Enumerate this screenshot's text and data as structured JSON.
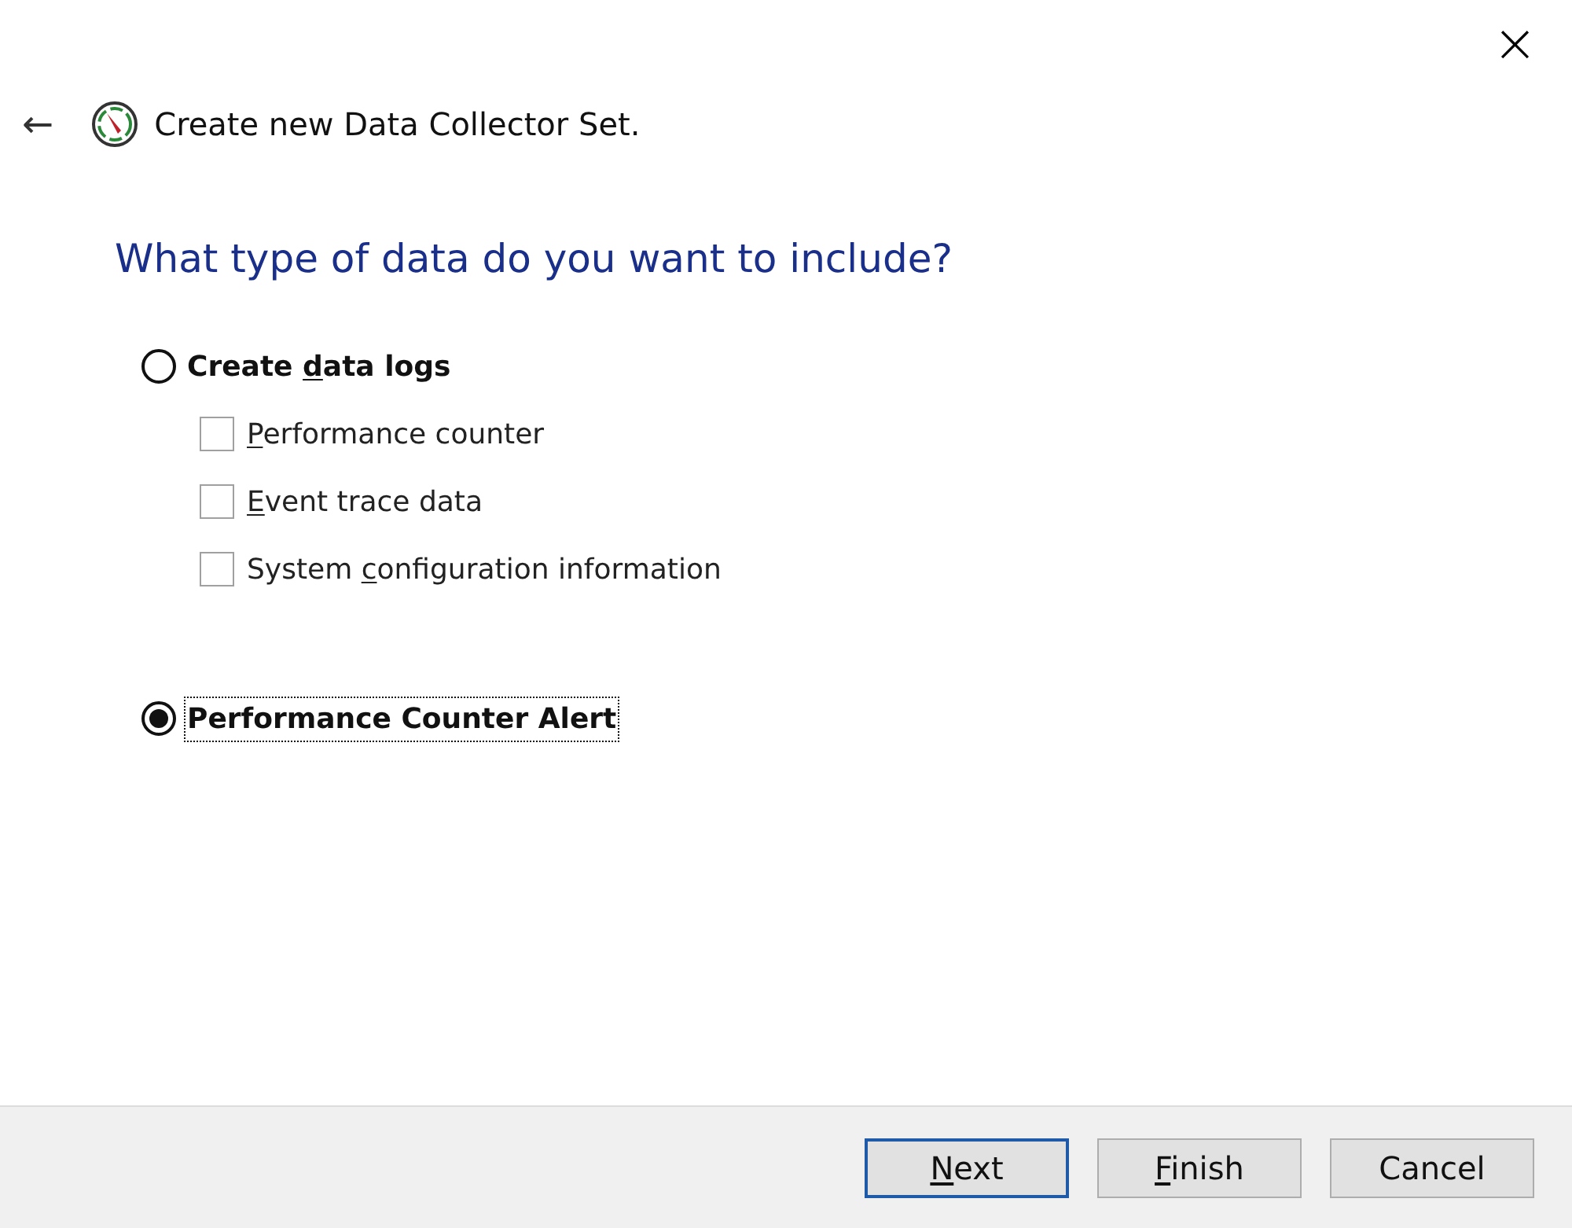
{
  "window": {
    "close": "×"
  },
  "header": {
    "back": "←",
    "title": "Create new Data Collector Set."
  },
  "heading": "What type of data do you want to include?",
  "options": [
    {
      "selected": false,
      "focused": false,
      "label_parts": [
        {
          "text": "Create ",
          "underline": false
        },
        {
          "text": "d",
          "underline": true
        },
        {
          "text": "ata logs",
          "underline": false
        }
      ],
      "children": [
        {
          "checked": false,
          "label_parts": [
            {
              "text": "P",
              "underline": true
            },
            {
              "text": "erformance counter",
              "underline": false
            }
          ]
        },
        {
          "checked": false,
          "label_parts": [
            {
              "text": "E",
              "underline": true
            },
            {
              "text": "vent trace data",
              "underline": false
            }
          ]
        },
        {
          "checked": false,
          "label_parts": [
            {
              "text": "System ",
              "underline": false
            },
            {
              "text": "c",
              "underline": true
            },
            {
              "text": "onfiguration information",
              "underline": false
            }
          ]
        }
      ]
    },
    {
      "selected": true,
      "focused": true,
      "label_parts": [
        {
          "text": "Performance Counter Alert",
          "underline": false
        }
      ]
    }
  ],
  "buttons": [
    {
      "default": true,
      "label_parts": [
        {
          "text": "N",
          "underline": true
        },
        {
          "text": "ext",
          "underline": false
        }
      ]
    },
    {
      "default": false,
      "label_parts": [
        {
          "text": "F",
          "underline": true
        },
        {
          "text": "inish",
          "underline": false
        }
      ]
    },
    {
      "default": false,
      "label_parts": [
        {
          "text": "Cancel",
          "underline": false
        }
      ]
    }
  ]
}
